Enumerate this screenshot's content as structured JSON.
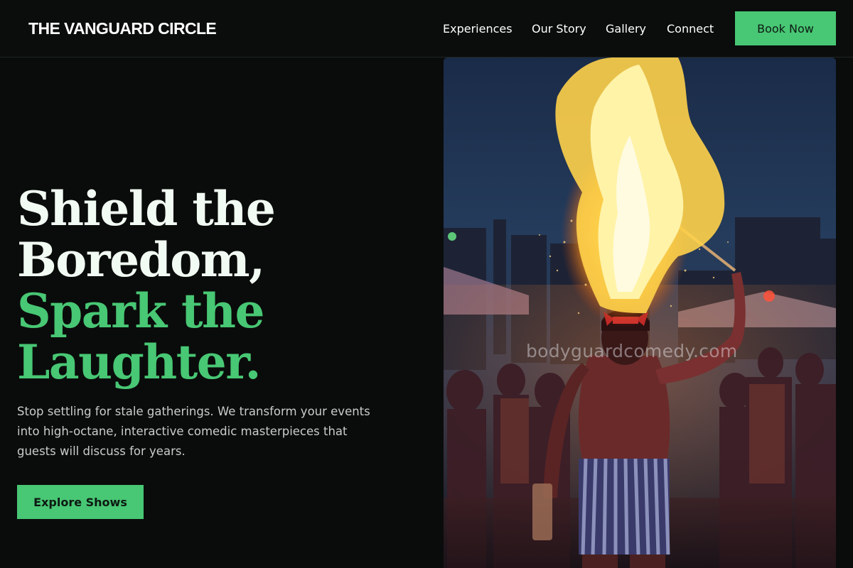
{
  "brand": {
    "name": "THE VANGUARD CIRCLE"
  },
  "nav": {
    "items": [
      {
        "label": "Experiences"
      },
      {
        "label": "Our Story"
      },
      {
        "label": "Gallery"
      },
      {
        "label": "Connect"
      }
    ],
    "cta_label": "Book Now"
  },
  "hero": {
    "title_white_1": "Shield the",
    "title_white_2": "Boredom,",
    "title_green_1": "Spark the",
    "title_green_2": "Laughter.",
    "description": "Stop settling for stale gatherings. We transform your events into high-octane, interactive comedic masterpieces that guests will discuss for years.",
    "button_label": "Explore Shows",
    "image_watermark": "bodyguardcomedy.com"
  },
  "colors": {
    "background": "#0a0c0b",
    "accent": "#48c774",
    "title_white": "#f2fbf3",
    "body_text": "#c9ccca"
  }
}
